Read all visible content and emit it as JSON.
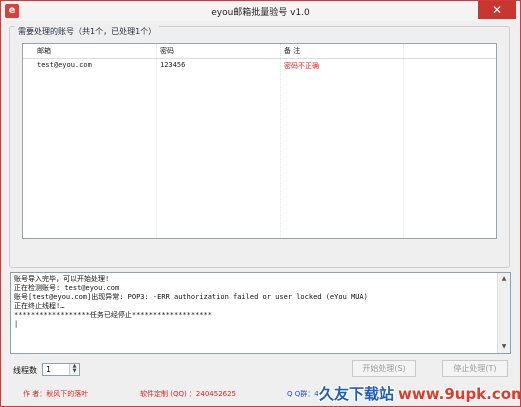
{
  "window": {
    "title": "eyou邮箱批量验号 v1.0",
    "close_glyph": "✕"
  },
  "group": {
    "legend": "需要处理的账号（共1个，已处理1个）",
    "columns": [
      "邮箱",
      "密码",
      "备 注"
    ],
    "rows": [
      {
        "email": "test@eyou.com",
        "password": "123456",
        "note": "密码不正确"
      }
    ]
  },
  "log": {
    "lines": [
      "账号导入完毕，可以开始处理!",
      "正在检测账号: test@eyou.com",
      "账号[test@eyou.com]出现异常: POP3: -ERR authorization failed or user locked (eYou MUA)",
      "正在终止线程!…",
      "******************任务已经停止*******************",
      "|"
    ]
  },
  "threads": {
    "label": "线程数",
    "value": "1"
  },
  "buttons": {
    "start": "开始处理(S)",
    "stop": "停止处理(T)"
  },
  "footer": {
    "author": "作  者：秋风下的落叶",
    "custom": "软件定制 (QQ) ：240452625",
    "qq_group": "Q Q群：4"
  },
  "watermark": {
    "brand": "久友下载站",
    "url": "www.9upk.com"
  },
  "colors": {
    "accent_red": "#d23b3b",
    "note_red": "#e22222",
    "link_blue": "#2a4ad0"
  },
  "icons": [
    "app-icon",
    "close-icon",
    "spin-up-icon",
    "spin-down-icon",
    "scroll-up-icon",
    "scroll-down-icon"
  ]
}
